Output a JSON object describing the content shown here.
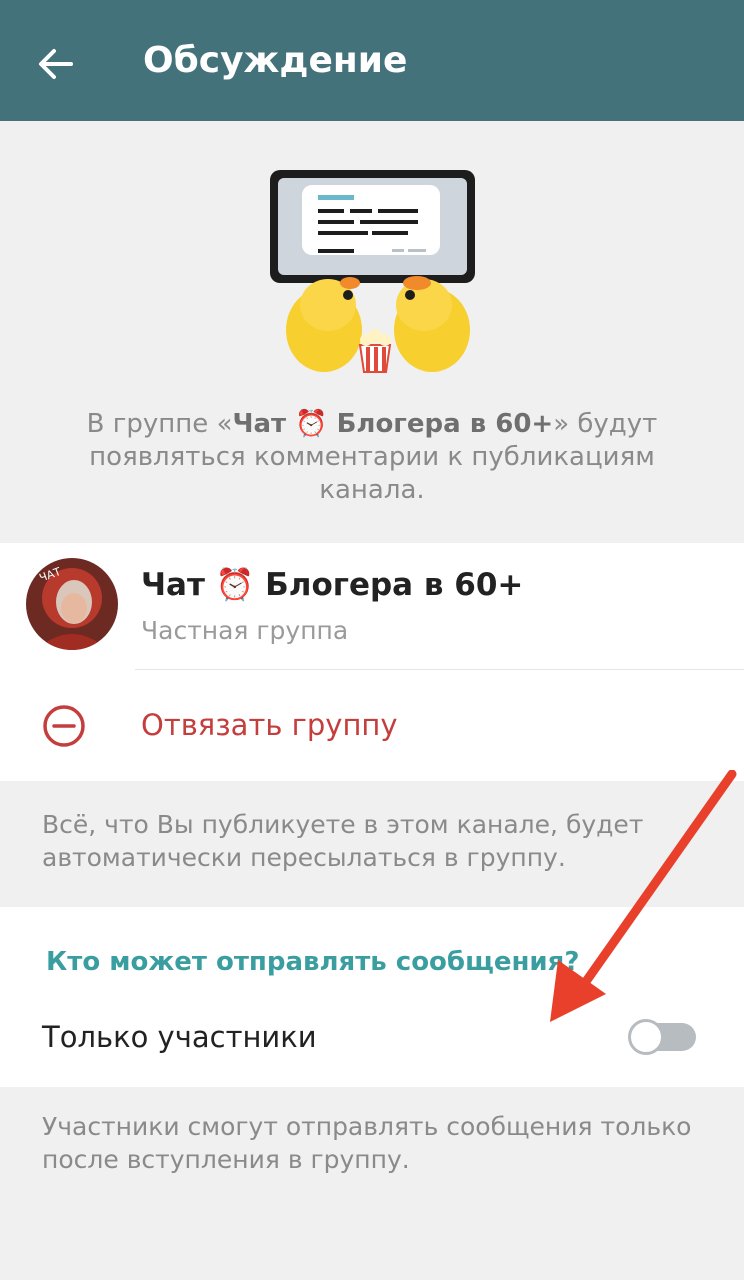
{
  "appbar": {
    "title": "Обсуждение",
    "back_icon": "arrow-left-icon",
    "background": "#43727b"
  },
  "intro": {
    "text_before": "В группе «",
    "group_bold": "Чат ⏰ Блогера в 60+",
    "text_after": "» будут появляться комментарии к публикациям канала."
  },
  "linked_group": {
    "name": "Чат ⏰ Блогера в 60+",
    "type": "Частная группа",
    "avatar_icon": "group-avatar"
  },
  "unlink": {
    "label": "Отвязать группу",
    "icon": "minus-circle-icon",
    "color": "#c43e3e"
  },
  "info_forward": "Всё, что Вы публикуете в этом канале, будет автоматически пересылаться в группу.",
  "permissions": {
    "title": "Кто может отправлять сообщения?",
    "title_color": "#3a9ea0",
    "toggle_label": "Только участники",
    "toggle_on": false
  },
  "info_members": "Участники смогут отправлять сообщения только после вступления в группу.",
  "annotation": {
    "arrow_color": "#e8402a"
  }
}
